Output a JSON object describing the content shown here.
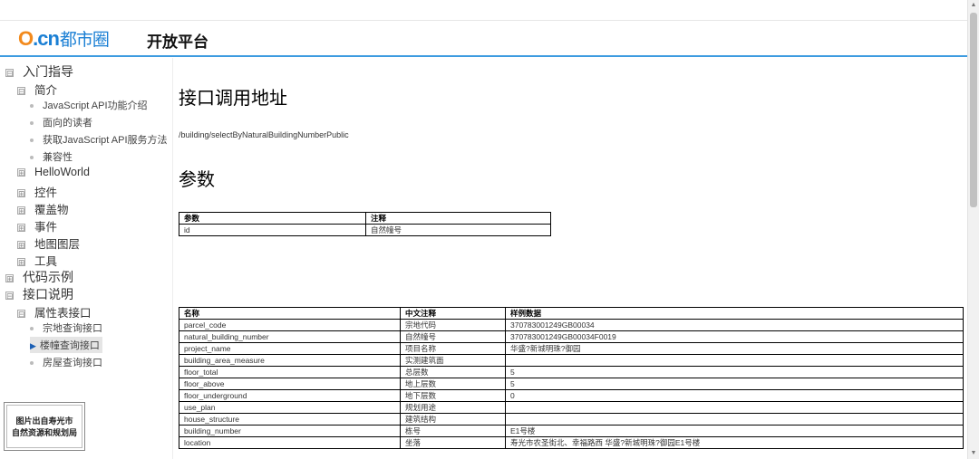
{
  "header": {
    "logo_o": "O",
    "logo_cn": ".cn",
    "logo_city": "都市圈",
    "platform": "开放平台"
  },
  "sidebar": {
    "items": [
      {
        "label": "入门指导",
        "toggle": "⊟"
      },
      {
        "label": "简介",
        "toggle": "⊟"
      },
      {
        "label": "JavaScript API功能介绍"
      },
      {
        "label": "面向的读者"
      },
      {
        "label": "获取JavaScript API服务方法"
      },
      {
        "label": "兼容性"
      },
      {
        "label": "HelloWorld",
        "toggle": "⊞"
      },
      {
        "label": "控件",
        "toggle": "⊞"
      },
      {
        "label": "覆盖物",
        "toggle": "⊞"
      },
      {
        "label": "事件",
        "toggle": "⊞"
      },
      {
        "label": "地图图层",
        "toggle": "⊞"
      },
      {
        "label": "工具",
        "toggle": "⊞"
      },
      {
        "label": "代码示例",
        "toggle": "⊞"
      },
      {
        "label": "接口说明",
        "toggle": "⊟"
      },
      {
        "label": "属性表接口",
        "toggle": "⊟"
      },
      {
        "label": "宗地查询接口"
      },
      {
        "label": "楼幢查询接口",
        "arrow": "▶"
      },
      {
        "label": "房屋查询接口"
      }
    ]
  },
  "badge": {
    "line1": "图片出自寿光市",
    "line2": "自然资源和规划局"
  },
  "main": {
    "title1": "接口调用地址",
    "endpoint": "/building/selectByNaturalBuildingNumberPublic",
    "title2": "参数",
    "params_table": {
      "headers": [
        "参数",
        "注释"
      ],
      "rows": [
        [
          "id",
          "自然幢号"
        ]
      ]
    },
    "fields_table": {
      "headers": [
        "名称",
        "中文注释",
        "样例数据"
      ],
      "rows": [
        [
          "parcel_code",
          "宗地代码",
          "370783001249GB00034"
        ],
        [
          "natural_building_number",
          "自然幢号",
          "370783001249GB00034F0019"
        ],
        [
          "project_name",
          "项目名称",
          "华盛?新城明珠?御园"
        ],
        [
          "building_area_measure",
          "实测建筑面",
          ""
        ],
        [
          "floor_total",
          "总层数",
          "5"
        ],
        [
          "floor_above",
          "地上层数",
          "5"
        ],
        [
          "floor_underground",
          "地下层数",
          "0"
        ],
        [
          "use_plan",
          "规划用途",
          ""
        ],
        [
          "house_structure",
          "建筑结构",
          ""
        ],
        [
          "building_number",
          "栋号",
          "E1号楼"
        ],
        [
          "location",
          "坐落",
          "寿光市农圣街北、幸福路西 华盛?新城明珠?御园E1号楼"
        ]
      ]
    }
  },
  "scrollbar": {
    "up": "▲",
    "down": "▼"
  }
}
